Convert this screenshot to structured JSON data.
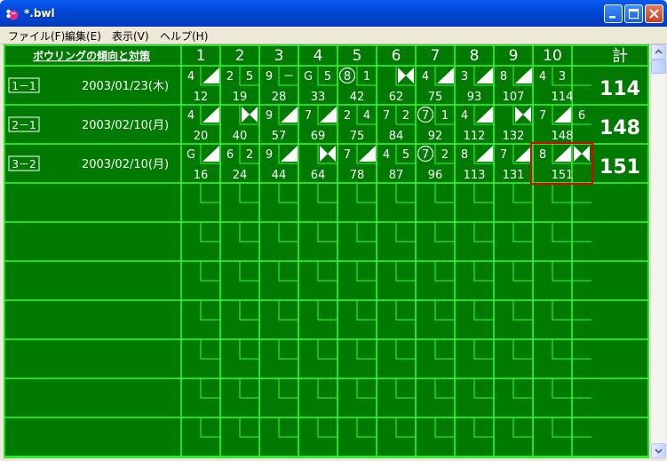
{
  "window": {
    "title": "*.bwl"
  },
  "menu": [
    {
      "label": "ファイル(F)"
    },
    {
      "label": "編集(E)"
    },
    {
      "label": "表示(V)"
    },
    {
      "label": "ヘルプ(H)"
    }
  ],
  "header": {
    "title": "ボウリングの傾向と対策",
    "frames": [
      "1",
      "2",
      "3",
      "4",
      "5",
      "6",
      "7",
      "8",
      "9",
      "10"
    ],
    "total_label": "計"
  },
  "games": [
    {
      "id": "1－1",
      "date": "2003/01/23(木)",
      "total": "114",
      "frames": [
        {
          "r": [
            {
              "t": "4"
            },
            {
              "t": "/"
            }
          ],
          "c": "12"
        },
        {
          "r": [
            {
              "t": "2"
            },
            {
              "t": "5"
            }
          ],
          "c": "19"
        },
        {
          "r": [
            {
              "t": "9"
            },
            {
              "t": "－"
            }
          ],
          "c": "28"
        },
        {
          "r": [
            {
              "t": "G"
            },
            {
              "t": "5"
            }
          ],
          "c": "33"
        },
        {
          "r": [
            {
              "t": "8",
              "split": true
            },
            {
              "t": "1"
            }
          ],
          "c": "42"
        },
        {
          "r": [
            {
              "t": ""
            },
            {
              "t": "X"
            }
          ],
          "c": "62"
        },
        {
          "r": [
            {
              "t": "4"
            },
            {
              "t": "/"
            }
          ],
          "c": "75"
        },
        {
          "r": [
            {
              "t": "3"
            },
            {
              "t": "/"
            }
          ],
          "c": "93"
        },
        {
          "r": [
            {
              "t": "8"
            },
            {
              "t": "/"
            }
          ],
          "c": "107"
        },
        {
          "r": [
            {
              "t": "4"
            },
            {
              "t": "3"
            },
            {
              "t": ""
            }
          ],
          "c": "114"
        }
      ]
    },
    {
      "id": "2－1",
      "date": "2003/02/10(月)",
      "total": "148",
      "frames": [
        {
          "r": [
            {
              "t": "4"
            },
            {
              "t": "/"
            }
          ],
          "c": "20"
        },
        {
          "r": [
            {
              "t": ""
            },
            {
              "t": "X"
            }
          ],
          "c": "40"
        },
        {
          "r": [
            {
              "t": "9"
            },
            {
              "t": "/"
            }
          ],
          "c": "57"
        },
        {
          "r": [
            {
              "t": "7"
            },
            {
              "t": "/"
            }
          ],
          "c": "69"
        },
        {
          "r": [
            {
              "t": "2"
            },
            {
              "t": "4"
            }
          ],
          "c": "75"
        },
        {
          "r": [
            {
              "t": "7"
            },
            {
              "t": "2"
            }
          ],
          "c": "84"
        },
        {
          "r": [
            {
              "t": "7",
              "split": true
            },
            {
              "t": "1"
            }
          ],
          "c": "92"
        },
        {
          "r": [
            {
              "t": "4"
            },
            {
              "t": "/"
            }
          ],
          "c": "112"
        },
        {
          "r": [
            {
              "t": ""
            },
            {
              "t": "X"
            }
          ],
          "c": "132"
        },
        {
          "r": [
            {
              "t": "7"
            },
            {
              "t": "/"
            },
            {
              "t": "6"
            }
          ],
          "c": "148"
        }
      ]
    },
    {
      "id": "3－2",
      "date": "2003/02/10(月)",
      "total": "151",
      "frames": [
        {
          "r": [
            {
              "t": "G"
            },
            {
              "t": "/"
            }
          ],
          "c": "16"
        },
        {
          "r": [
            {
              "t": "6"
            },
            {
              "t": "2"
            }
          ],
          "c": "24"
        },
        {
          "r": [
            {
              "t": "9"
            },
            {
              "t": "/"
            }
          ],
          "c": "44"
        },
        {
          "r": [
            {
              "t": ""
            },
            {
              "t": "X"
            }
          ],
          "c": "64"
        },
        {
          "r": [
            {
              "t": "7"
            },
            {
              "t": "/"
            }
          ],
          "c": "78"
        },
        {
          "r": [
            {
              "t": "4"
            },
            {
              "t": "5"
            }
          ],
          "c": "87"
        },
        {
          "r": [
            {
              "t": "7",
              "split": true
            },
            {
              "t": "2"
            }
          ],
          "c": "96"
        },
        {
          "r": [
            {
              "t": "8"
            },
            {
              "t": "/"
            }
          ],
          "c": "113"
        },
        {
          "r": [
            {
              "t": "7"
            },
            {
              "t": "/"
            }
          ],
          "c": "131"
        },
        {
          "r": [
            {
              "t": "8"
            },
            {
              "t": "/"
            },
            {
              "t": "X"
            }
          ],
          "c": "151"
        }
      ]
    }
  ],
  "empty_rows": 7,
  "selected": {
    "game": 3,
    "frame": 10
  },
  "colors": {
    "board": "#007a00",
    "grid": "#33ff33",
    "text": "#ffffff",
    "selection": "#e00000"
  }
}
